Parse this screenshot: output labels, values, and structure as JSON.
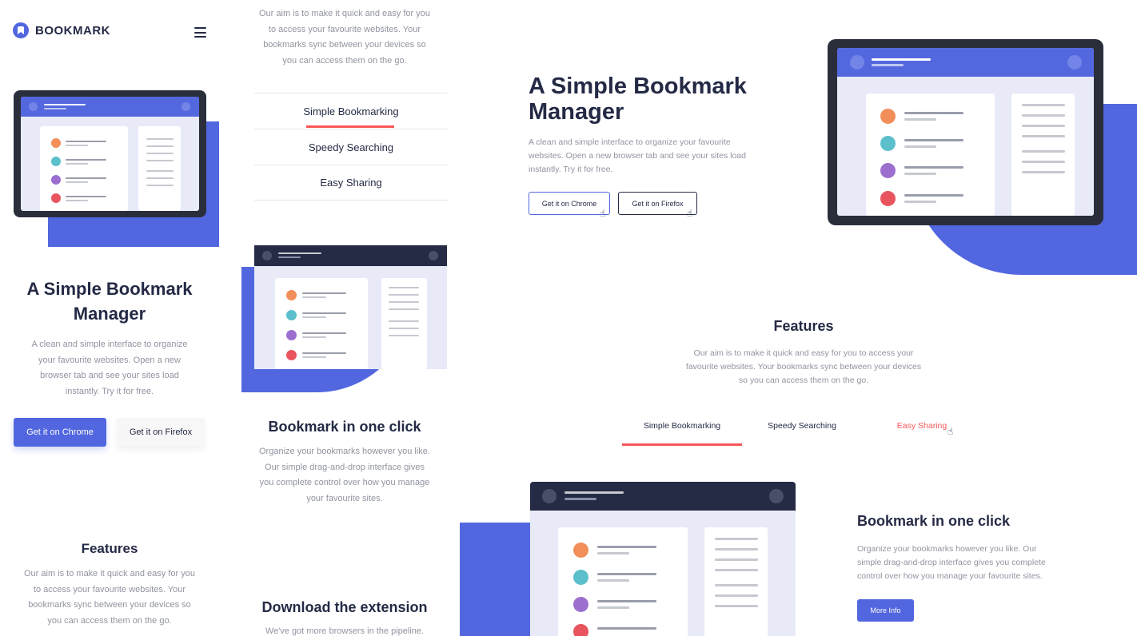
{
  "brand": {
    "name": "BOOKMARK"
  },
  "icons": {
    "menu": "hamburger-icon",
    "logo": "bookmark-logo-icon",
    "cursor": "pointer-cursor-icon"
  },
  "colors": {
    "primary": "#5267DF",
    "accent_red": "#FA5757",
    "dark": "#242A45",
    "grey_text": "#9194A1"
  },
  "hero": {
    "title_line1": "A Simple Bookmark",
    "title_line2": "Manager",
    "description_mobile": [
      "A clean and simple interface to organize",
      "your favourite websites. Open a new",
      "browser tab and see your sites load",
      "instantly. Try it for free."
    ],
    "description_desktop": [
      "A clean and simple interface to organize your favourite",
      "websites. Open a new browser tab and see your sites load",
      "instantly. Try it for free."
    ],
    "cta_chrome": "Get it on Chrome",
    "cta_firefox": "Get it on Firefox"
  },
  "features": {
    "title": "Features",
    "description_mobile": [
      "Our aim is to make it quick and easy for you",
      "to access your favourite websites. Your",
      "bookmarks sync between your devices so",
      "you can access them on the go."
    ],
    "description_desktop": [
      "Our aim is to make it quick and easy for you to access your",
      "favourite websites. Your bookmarks sync between your devices",
      "so you can access them on the go."
    ],
    "tabs": [
      "Simple Bookmarking",
      "Speedy Searching",
      "Easy Sharing"
    ]
  },
  "feature_detail": {
    "title": "Bookmark in one click",
    "description_mobile": [
      "Organize your bookmarks however you like.",
      "Our simple drag-and-drop interface gives",
      "you complete control over how you manage",
      "your favourite sites."
    ],
    "description_desktop": [
      "Organize your bookmarks however you like. Our",
      "simple drag-and-drop interface gives you complete",
      "control over how you manage your favourite sites."
    ],
    "more_info": "More Info"
  },
  "download": {
    "title": "Download the extension",
    "description_start": "We've got more browsers in the pipeline."
  }
}
